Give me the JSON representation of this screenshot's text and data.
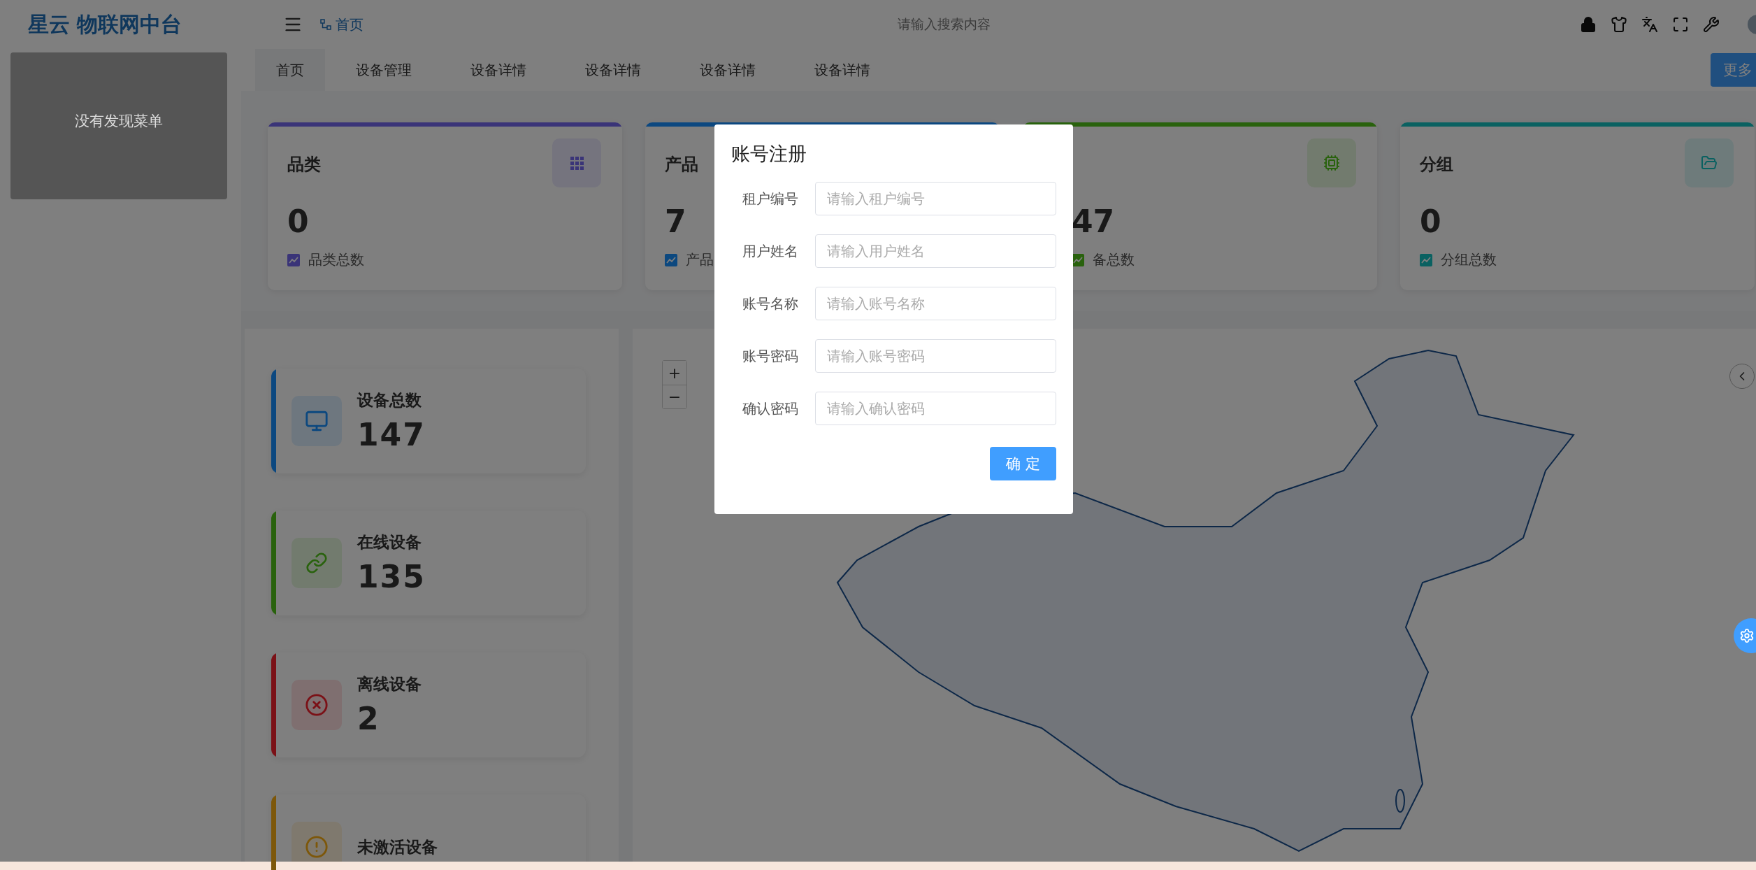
{
  "header": {
    "logo": "星云 物联网中台",
    "breadcrumb": "首页",
    "search": {
      "placeholder": "请输入搜索内容"
    }
  },
  "sidebar": {
    "empty_text": "没有发现菜单"
  },
  "tabs": [
    {
      "label": "首页",
      "selected": true
    },
    {
      "label": "设备管理",
      "selected": false
    },
    {
      "label": "设备详情",
      "selected": false
    },
    {
      "label": "设备详情",
      "selected": false
    },
    {
      "label": "设备详情",
      "selected": false
    },
    {
      "label": "设备详情",
      "selected": false
    }
  ],
  "more_button": "更多",
  "stat_cards": [
    {
      "title": "品类",
      "value": "0",
      "label": "品类总数",
      "color": "#3a3478",
      "kind": "grid"
    },
    {
      "title": "产品",
      "value": "7",
      "label": "产品",
      "color": "#0c4880"
    },
    {
      "value": "47",
      "label": "备总数",
      "color": "#29620d",
      "kind": "chip"
    },
    {
      "title": "分组",
      "value": "0",
      "label": "分组总数",
      "color": "#0a6161",
      "kind": "folder"
    }
  ],
  "device_cards": [
    {
      "title": "设备总数",
      "value": "147",
      "color": "#0c4880",
      "kind": "monitor"
    },
    {
      "title": "在线设备",
      "value": "135",
      "color": "#29620d",
      "kind": "link"
    },
    {
      "title": "离线设备",
      "value": "2",
      "color": "#7b1117",
      "kind": "offline"
    },
    {
      "title": "未激活设备",
      "color": "#7d570a",
      "kind": "alert"
    }
  ],
  "map": {
    "zoom_in": "+",
    "zoom_out": "−"
  },
  "dialog": {
    "title": "账号注册",
    "fields": [
      {
        "label": "租户编号",
        "placeholder": "请输入租户编号"
      },
      {
        "label": "用户姓名",
        "placeholder": "请输入用户姓名"
      },
      {
        "label": "账号名称",
        "placeholder": "请输入账号名称"
      },
      {
        "label": "账号密码",
        "placeholder": "请输入账号密码"
      },
      {
        "label": "确认密码",
        "placeholder": "请输入确认密码"
      }
    ],
    "confirm": "确 定"
  }
}
